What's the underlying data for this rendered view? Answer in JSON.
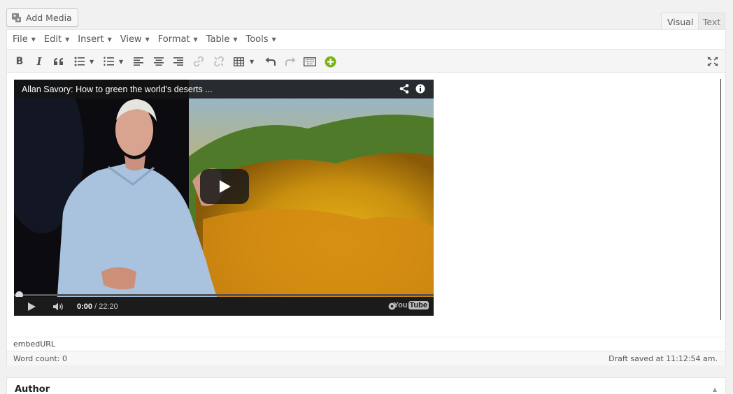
{
  "media": {
    "add_media_label": "Add Media"
  },
  "mode_tabs": {
    "visual": "Visual",
    "text": "Text"
  },
  "menubar": [
    {
      "label": "File"
    },
    {
      "label": "Edit"
    },
    {
      "label": "Insert"
    },
    {
      "label": "View"
    },
    {
      "label": "Format"
    },
    {
      "label": "Table"
    },
    {
      "label": "Tools"
    }
  ],
  "toolbar": {
    "bold": "B",
    "italic": "I",
    "blockquote": "66",
    "icons": [
      "bold-icon",
      "italic-icon",
      "blockquote-icon",
      "bullet-list-icon",
      "numbered-list-icon",
      "align-left-icon",
      "align-center-icon",
      "align-right-icon",
      "link-icon",
      "unlink-icon",
      "table-icon",
      "undo-icon",
      "redo-icon",
      "keyboard-icon",
      "add-plus-icon",
      "fullscreen-icon"
    ]
  },
  "video": {
    "title": "Allan Savory: How to green the world's deserts ...",
    "current_time": "0:00",
    "total_time": "/ 22:20",
    "progress": 0,
    "brand_you": "You",
    "brand_tube": "Tube"
  },
  "path": "embedURL",
  "status": {
    "word_count": "Word count: 0",
    "draft_saved": "Draft saved at 11:12:54 am."
  },
  "author_box": {
    "title": "Author"
  },
  "colors": {
    "accent_plus": "#7ab317",
    "video_bg": "#1b1b1b"
  }
}
